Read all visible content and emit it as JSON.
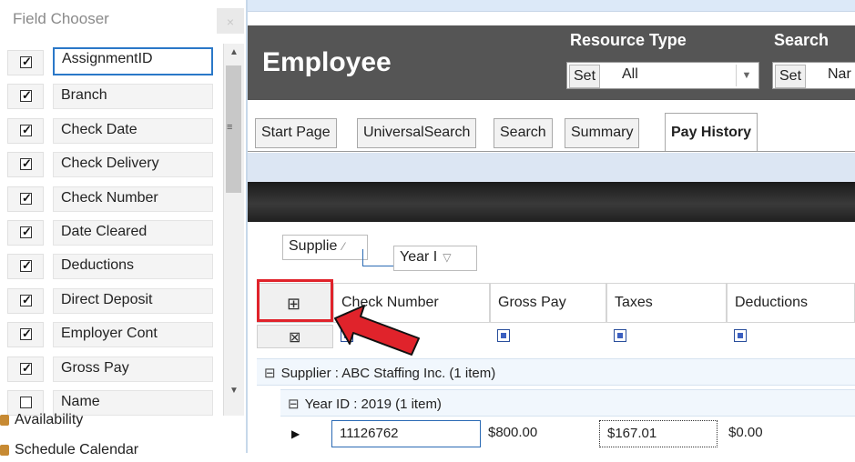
{
  "field_chooser": {
    "title": "Field Chooser",
    "close_glyph": "×",
    "fields": [
      {
        "label": "AssignmentID",
        "checked": true,
        "selected": true
      },
      {
        "label": "Branch",
        "checked": true
      },
      {
        "label": "Check Date",
        "checked": true
      },
      {
        "label": "Check Delivery",
        "checked": true
      },
      {
        "label": "Check Number",
        "checked": true
      },
      {
        "label": "Date Cleared",
        "checked": true
      },
      {
        "label": "Deductions",
        "checked": true
      },
      {
        "label": "Direct Deposit",
        "checked": true
      },
      {
        "label": "Employer Cont",
        "checked": true
      },
      {
        "label": "Gross Pay",
        "checked": true
      },
      {
        "label": "Name",
        "checked": false
      }
    ],
    "footer_items": [
      "Availability",
      "Schedule Calendar"
    ]
  },
  "header": {
    "title": "Employee",
    "resource_type_label": "Resource Type",
    "resource_type_set": "Set",
    "resource_type_value": "All",
    "search_label": "Search",
    "search_set": "Set",
    "search_value": "Nar"
  },
  "tabs": [
    "Start Page",
    "UniversalSearch",
    "Search",
    "Summary",
    "Pay History"
  ],
  "active_tab": "Pay History",
  "grid": {
    "group_chips": [
      "Supplie",
      "Year I"
    ],
    "columns": [
      "Check Number",
      "Gross Pay",
      "Taxes",
      "Deductions"
    ],
    "group_level1": "Supplier : ABC Staffing Inc.  (1 item)",
    "group_level2": "Year ID : 2019  (1 item)",
    "row": [
      "11126762",
      "$800.00",
      "$167.01",
      "$0.00"
    ]
  },
  "colors": {
    "header_bg": "#555555",
    "highlight": "#e0232b",
    "selection_blue": "#2a78c8"
  }
}
